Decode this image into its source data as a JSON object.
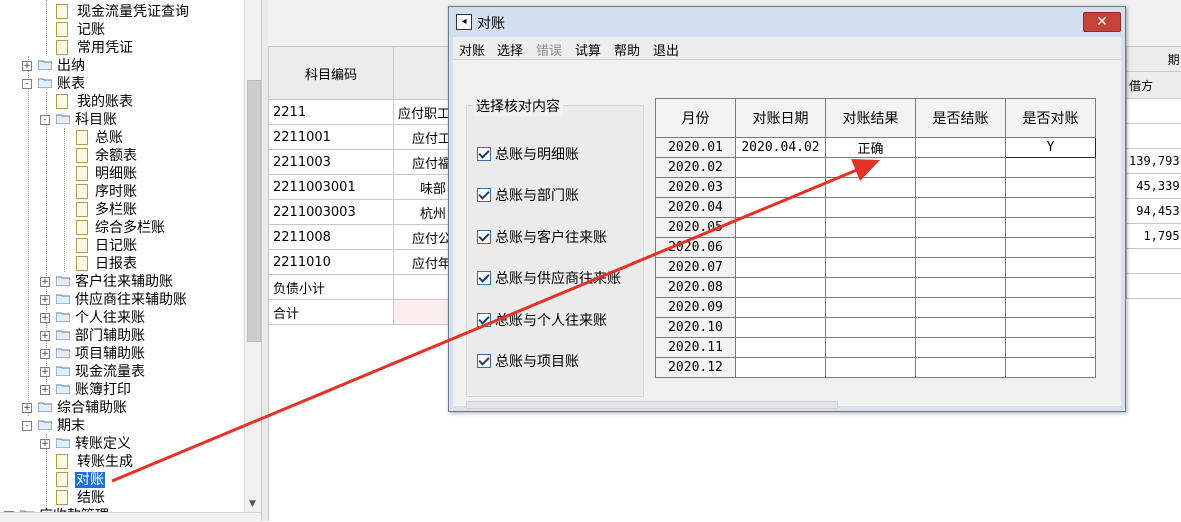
{
  "tree": {
    "nodes": [
      {
        "label": "现金流量凭证查询",
        "level": 3,
        "type": "doc"
      },
      {
        "label": "记账",
        "level": 3,
        "type": "doc"
      },
      {
        "label": "常用凭证",
        "level": 3,
        "type": "doc"
      },
      {
        "label": "出纳",
        "level": 1,
        "type": "folder",
        "expander": "+"
      },
      {
        "label": "账表",
        "level": 1,
        "type": "folder",
        "expander": "-"
      },
      {
        "label": "我的账表",
        "level": 2,
        "type": "doc"
      },
      {
        "label": "科目账",
        "level": 2,
        "type": "folder",
        "expander": "-"
      },
      {
        "label": "总账",
        "level": 3,
        "type": "doc"
      },
      {
        "label": "余额表",
        "level": 3,
        "type": "doc"
      },
      {
        "label": "明细账",
        "level": 3,
        "type": "doc"
      },
      {
        "label": "序时账",
        "level": 3,
        "type": "doc"
      },
      {
        "label": "多栏账",
        "level": 3,
        "type": "doc"
      },
      {
        "label": "综合多栏账",
        "level": 3,
        "type": "doc"
      },
      {
        "label": "日记账",
        "level": 3,
        "type": "doc"
      },
      {
        "label": "日报表",
        "level": 3,
        "type": "doc"
      },
      {
        "label": "客户往来辅助账",
        "level": 2,
        "type": "folder",
        "expander": "+"
      },
      {
        "label": "供应商往来辅助账",
        "level": 2,
        "type": "folder",
        "expander": "+"
      },
      {
        "label": "个人往来账",
        "level": 2,
        "type": "folder",
        "expander": "+"
      },
      {
        "label": "部门辅助账",
        "level": 2,
        "type": "folder",
        "expander": "+"
      },
      {
        "label": "项目辅助账",
        "level": 2,
        "type": "folder",
        "expander": "+"
      },
      {
        "label": "现金流量表",
        "level": 2,
        "type": "folder",
        "expander": "+"
      },
      {
        "label": "账簿打印",
        "level": 2,
        "type": "folder",
        "expander": "+"
      },
      {
        "label": "综合辅助账",
        "level": 1,
        "type": "folder",
        "expander": "+"
      },
      {
        "label": "期末",
        "level": 1,
        "type": "folder",
        "expander": "-"
      },
      {
        "label": "转账定义",
        "level": 2,
        "type": "folder",
        "expander": "+"
      },
      {
        "label": "转账生成",
        "level": 2,
        "type": "doc"
      },
      {
        "label": "对账",
        "level": 2,
        "type": "doc",
        "selected": true
      },
      {
        "label": "结账",
        "level": 2,
        "type": "doc"
      },
      {
        "label": "应收款管理",
        "level": 0,
        "type": "folder",
        "expander": "+"
      }
    ]
  },
  "background_table": {
    "header_code": "科目编码",
    "header_debit": "借方",
    "header_right_partial": "期",
    "rows": [
      {
        "code": "2211",
        "name": "应付职工"
      },
      {
        "code": "2211001",
        "name": "应付工"
      },
      {
        "code": "2211003",
        "name": "应付福",
        "debit": "139,793"
      },
      {
        "code": "2211003001",
        "name": "味部",
        "debit": "45,339"
      },
      {
        "code": "2211003003",
        "name": "杭州",
        "debit": "94,453"
      },
      {
        "code": "2211008",
        "name": "应付公",
        "debit": "1,795"
      },
      {
        "code": "2211010",
        "name": "应付年"
      },
      {
        "code": "负债小计",
        "name": ""
      },
      {
        "code": "合计",
        "name": ""
      }
    ]
  },
  "dialog": {
    "title": "对账",
    "close_label": "✕",
    "menu": [
      "对账",
      "选择",
      "错误",
      "试算",
      "帮助",
      "退出"
    ],
    "group_title": "选择核对内容",
    "checks": [
      "总账与明细账",
      "总账与部门账",
      "总账与客户往来账",
      "总账与供应商往来账",
      "总账与个人往来账",
      "总账与项目账"
    ],
    "grid": {
      "columns": [
        "月份",
        "对账日期",
        "对账结果",
        "是否结账",
        "是否对账"
      ],
      "months": [
        "2020.01",
        "2020.02",
        "2020.03",
        "2020.04",
        "2020.05",
        "2020.06",
        "2020.07",
        "2020.08",
        "2020.09",
        "2020.10",
        "2020.11",
        "2020.12"
      ],
      "first_row": {
        "date": "2020.04.02",
        "result": "正确",
        "closed": "",
        "reconciled": "Y"
      }
    }
  },
  "colors": {
    "annotation_arrow": "#e53226",
    "selection": "#1e6fd9",
    "close_button": "#c7433a"
  }
}
